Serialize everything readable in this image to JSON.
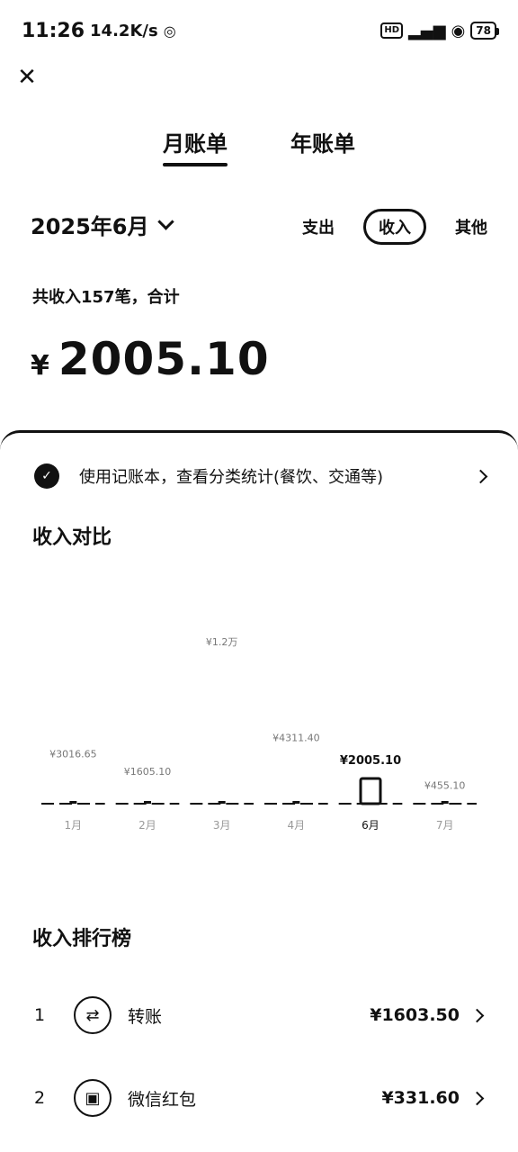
{
  "status": {
    "time": "11:26",
    "speed": "14.2K/s",
    "battery": "78"
  },
  "tabs": [
    {
      "label": "月账单",
      "active": true
    },
    {
      "label": "年账单",
      "active": false
    }
  ],
  "filter": {
    "month": "2025年6月",
    "options": [
      "支出",
      "收入",
      "其他"
    ],
    "selected": "收入"
  },
  "summary": {
    "text": "共收入157笔，合计",
    "currency": "¥",
    "total": "2005.10"
  },
  "promo": {
    "text": "使用记账本，查看分类统计(餐饮、交通等)"
  },
  "comparison": {
    "title": "收入对比"
  },
  "chart_data": {
    "type": "bar",
    "title": "收入对比",
    "categories": [
      "1月",
      "2月",
      "3月",
      "4月",
      "6月",
      "7月"
    ],
    "values": [
      3016.65,
      1605.1,
      12000,
      4311.4,
      2005.1,
      455.1
    ],
    "value_labels": [
      "¥3016.65",
      "¥1605.10",
      "¥1.2万",
      "¥4311.40",
      "¥2005.10",
      "¥455.10"
    ],
    "highlight_index": 4
  },
  "ranking": {
    "title": "收入排行榜",
    "items": [
      {
        "rank": "1",
        "name": "转账",
        "amount": "¥1603.50",
        "icon": "transfer-icon"
      },
      {
        "rank": "2",
        "name": "微信红包",
        "amount": "¥331.60",
        "icon": "red-packet-icon"
      }
    ]
  },
  "colors": {
    "text": "#111111",
    "background": "#ffffff"
  }
}
